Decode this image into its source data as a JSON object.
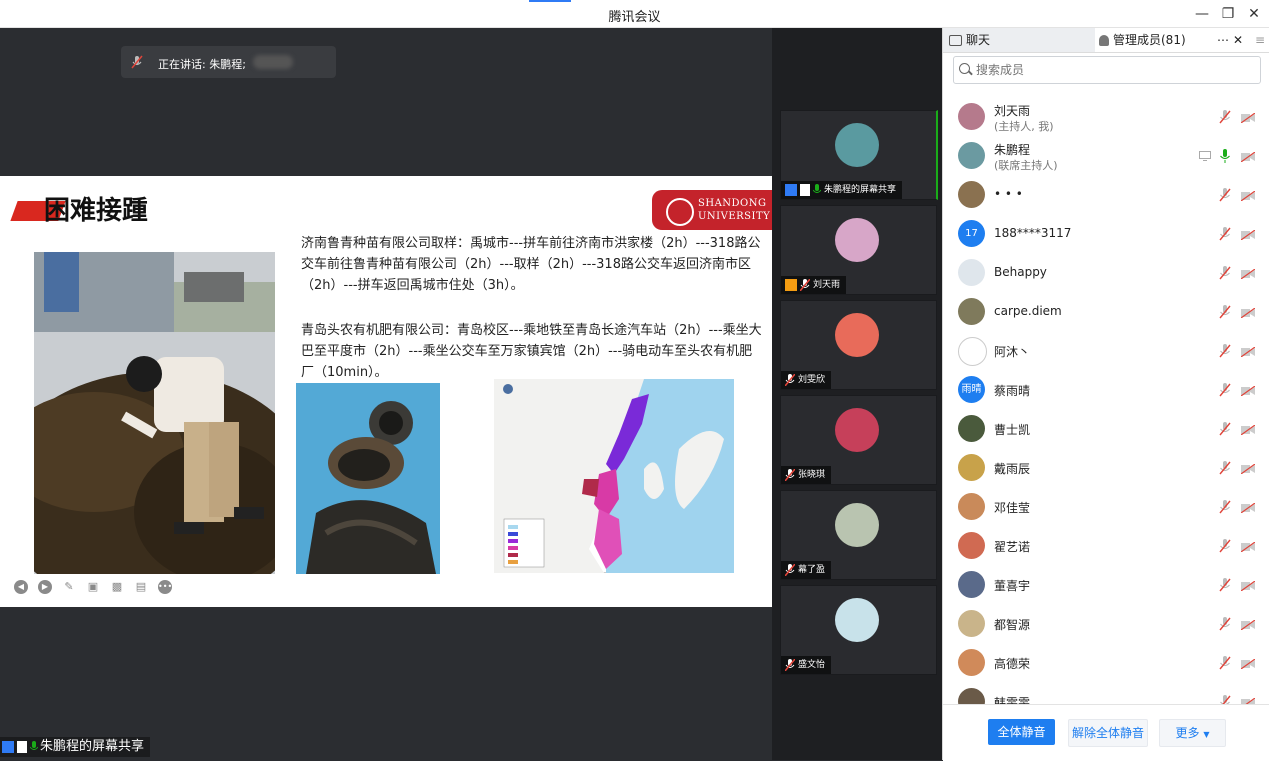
{
  "window": {
    "title": "腾讯会议"
  },
  "stage": {
    "speaking_label": "正在讲话: 朱鹏程;",
    "share_label": "朱鹏程的屏幕共享"
  },
  "slide": {
    "heading": "困难接踵",
    "logo_line1": "SHANDONG",
    "logo_line2": "UNIVERSITY",
    "para1": "济南鲁青种苗有限公司取样：禹城市---拼车前往济南市洪家楼（2h）---318路公交车前往鲁青种苗有限公司（2h）---取样（2h）---318路公交车返回济南市区（2h）---拼车返回禹城市住处（3h）。",
    "para2": "青岛头农有机肥有限公司：青岛校区---乘地铁至青岛长途汽车站（2h）---乘坐大巴至平度市（2h）---乘坐公交车至万家镇宾馆（2h）---骑电动车至头农有机肥厂（10min）。"
  },
  "thumbnails": [
    {
      "name": "朱鹏程的屏幕共享",
      "avatar_color": "#5a9aa0",
      "active": true,
      "icons": [
        "person",
        "screen",
        "mic"
      ]
    },
    {
      "name": "刘天雨",
      "avatar_color": "#d7a6c8",
      "active": false,
      "icons": [
        "person-orange",
        "mic-muted"
      ]
    },
    {
      "name": "刘雯欣",
      "avatar_color": "#e86b5a",
      "active": false,
      "icons": [
        "mic-muted"
      ]
    },
    {
      "name": "张晓琪",
      "avatar_color": "#c6405a",
      "active": false,
      "icons": [
        "mic-muted"
      ]
    },
    {
      "name": "幕了盈",
      "avatar_color": "#b9c4b0",
      "active": false,
      "icons": [
        "mic-muted"
      ]
    },
    {
      "name": "盛文怡",
      "avatar_color": "#c8e2ea",
      "active": false,
      "icons": [
        "mic-muted"
      ]
    }
  ],
  "panel": {
    "tab_chat": "聊天",
    "tab_members": "管理成员(81)",
    "search_placeholder": "搜索成员",
    "members": [
      {
        "name": "刘天雨",
        "sub": "(主持人, 我)",
        "avatar_color": "#b57a8c",
        "avatar_text": "",
        "mic": "muted",
        "screen": false
      },
      {
        "name": "朱鹏程",
        "sub": "(联席主持人)",
        "avatar_color": "#6b9aa1",
        "avatar_text": "",
        "mic": "on",
        "screen": true
      },
      {
        "name": "• • •",
        "sub": "",
        "avatar_color": "#8a7150",
        "avatar_text": "",
        "mic": "muted",
        "screen": false
      },
      {
        "name": "188****3117",
        "sub": "",
        "avatar_color": "#1e7ef0",
        "avatar_text": "17",
        "mic": "muted",
        "screen": false
      },
      {
        "name": "Behappy",
        "sub": "",
        "avatar_color": "#dfe6ec",
        "avatar_text": "",
        "mic": "muted",
        "screen": false
      },
      {
        "name": "carpe.diem",
        "sub": "",
        "avatar_color": "#7f7a5c",
        "avatar_text": "",
        "mic": "muted",
        "screen": false
      },
      {
        "name": "阿沐丶",
        "sub": "",
        "avatar_color": "#ffffff",
        "avatar_text": "",
        "mic": "muted",
        "screen": false
      },
      {
        "name": "蔡雨晴",
        "sub": "",
        "avatar_color": "#1e7ef0",
        "avatar_text": "雨晴",
        "mic": "muted",
        "screen": false
      },
      {
        "name": "曹士凯",
        "sub": "",
        "avatar_color": "#4a5a3c",
        "avatar_text": "",
        "mic": "muted",
        "screen": false
      },
      {
        "name": "戴雨辰",
        "sub": "",
        "avatar_color": "#c8a24a",
        "avatar_text": "",
        "mic": "muted",
        "screen": false
      },
      {
        "name": "邓佳莹",
        "sub": "",
        "avatar_color": "#c98a5a",
        "avatar_text": "",
        "mic": "muted",
        "screen": false
      },
      {
        "name": "翟艺诺",
        "sub": "",
        "avatar_color": "#d06a52",
        "avatar_text": "",
        "mic": "muted",
        "screen": false
      },
      {
        "name": "董喜宇",
        "sub": "",
        "avatar_color": "#5a6a8a",
        "avatar_text": "",
        "mic": "muted",
        "screen": false
      },
      {
        "name": "都智源",
        "sub": "",
        "avatar_color": "#c9b48a",
        "avatar_text": "",
        "mic": "muted",
        "screen": false
      },
      {
        "name": "高德荣",
        "sub": "",
        "avatar_color": "#d08a5a",
        "avatar_text": "",
        "mic": "muted",
        "screen": false
      },
      {
        "name": "韩雯雯",
        "sub": "",
        "avatar_color": "#6a5a48",
        "avatar_text": "",
        "mic": "muted",
        "screen": false
      }
    ],
    "btn_mute_all": "全体静音",
    "btn_unmute_all": "解除全体静音",
    "btn_more": "更多"
  },
  "colors": {
    "accent_blue": "#1e7ef0",
    "mic_green": "#1aad19",
    "muted_red": "#e0443a",
    "brand_red": "#c4232b"
  }
}
